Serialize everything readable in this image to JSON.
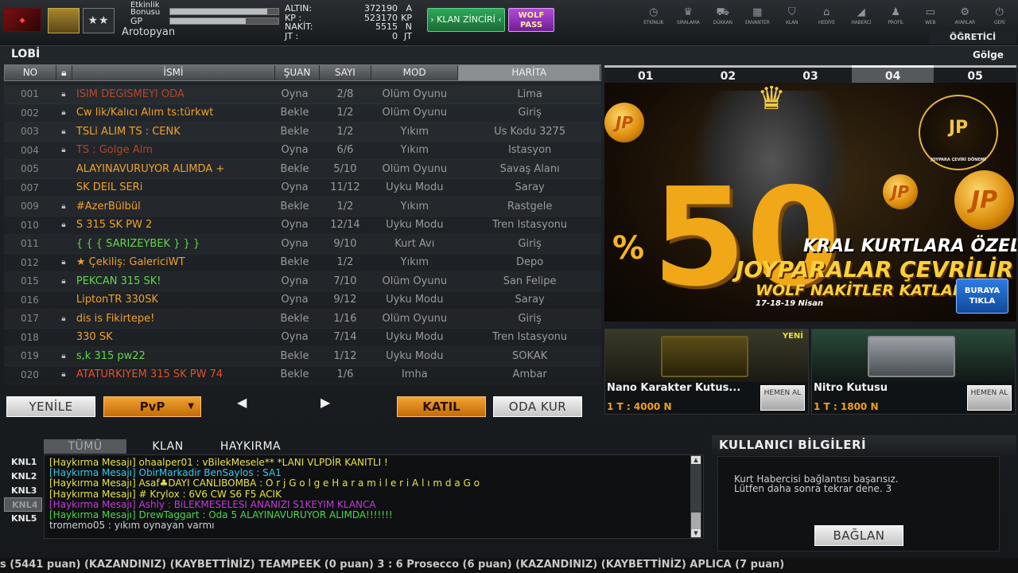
{
  "header": {
    "brand_logo_icon": "game-logo-icon",
    "rank_icon": "rank-badge-icon",
    "stars_text": "★★",
    "event_bonus_label": "Etkinlik",
    "event_bonus_label2": "Bonusu",
    "gp_label": "GP",
    "event_bonus_progress": 0.9,
    "gp_progress": 0.7,
    "username": "Arotopyan",
    "currency": [
      {
        "key": "ALTIN:",
        "value": "372190",
        "unit": "A"
      },
      {
        "key": "KP   :",
        "value": "523170",
        "unit": "KP"
      },
      {
        "key": "NAKİT:",
        "value": "5515",
        "unit": "N"
      },
      {
        "key": "JT   :",
        "value": "0",
        "unit": "JT"
      }
    ],
    "klan_chain_label": "› KLAN ZİNCİRİ ‹",
    "wolf_pass_line1": "WOLF",
    "wolf_pass_line2": "PASS",
    "nav": [
      {
        "label": "ETKİNLİK",
        "icon": "clock-icon",
        "glyph": "◷"
      },
      {
        "label": "SIRALAMA",
        "icon": "rank-icon",
        "glyph": "♛"
      },
      {
        "label": "DÜKKAN",
        "icon": "cart-icon",
        "glyph": "⛟"
      },
      {
        "label": "ENVANTER",
        "icon": "inventory-icon",
        "glyph": "▦"
      },
      {
        "label": "KLAN",
        "icon": "clan-shield-icon",
        "glyph": "⛉"
      },
      {
        "label": "HEDİYE",
        "icon": "gift-icon",
        "glyph": "⌂"
      },
      {
        "label": "HABERCİ",
        "icon": "megaphone-icon",
        "glyph": "◢"
      },
      {
        "label": "PROFİL",
        "icon": "profile-icon",
        "glyph": "♟"
      },
      {
        "label": "WEB",
        "icon": "web-icon",
        "glyph": "▭"
      },
      {
        "label": "AYARLAR",
        "icon": "settings-gear-icon",
        "glyph": "⚙"
      },
      {
        "label": "GERİ",
        "icon": "power-icon",
        "glyph": "⏻"
      }
    ],
    "tutor_label": "ÖĞRETİCİ"
  },
  "lobby": {
    "title": "LOBİ",
    "columns": {
      "no": "NO",
      "lock_icon": "lock-icon",
      "name": "İSMİ",
      "status": "ŞUAN",
      "count": "SAYI",
      "mode": "MOD",
      "map": "HARİTA"
    },
    "rooms": [
      {
        "no": "001",
        "locked": true,
        "name": "ISIM DEGISMEYI ODA",
        "name_color": "#e0532a",
        "status": "Oyna",
        "count": "2/8",
        "mode": "Ölüm Oyunu",
        "map": "Lima",
        "dim": true
      },
      {
        "no": "002",
        "locked": true,
        "name": "Cw lik/Kalıcı Alım ts:türkwt",
        "name_color": "#f0a12a",
        "status": "Bekle",
        "count": "1/2",
        "mode": "Ölüm Oyunu",
        "map": "Giriş",
        "dim": false
      },
      {
        "no": "003",
        "locked": true,
        "name": "TSLi ALIM  TS : CENK",
        "name_color": "#f0a12a",
        "status": "Bekle",
        "count": "1/2",
        "mode": "Yıkım",
        "map": "Üs Kodu 3275",
        "dim": false
      },
      {
        "no": "004",
        "locked": true,
        "name": "TS : Golge Alm",
        "name_color": "#e0532a",
        "status": "Oyna",
        "count": "6/6",
        "mode": "Yıkım",
        "map": "İstasyon",
        "dim": true
      },
      {
        "no": "005",
        "locked": false,
        "name": "ALAYINAVURUYOR ALIMDA +",
        "name_color": "#f0a12a",
        "status": "Bekle",
        "count": "5/10",
        "mode": "Ölüm Oyunu",
        "map": "Savaş Alanı",
        "dim": false
      },
      {
        "no": "007",
        "locked": false,
        "name": "SK DEIL SERi",
        "name_color": "#f0a12a",
        "status": "Oyna",
        "count": "11/12",
        "mode": "Uyku Modu",
        "map": "Saray",
        "dim": false
      },
      {
        "no": "009",
        "locked": true,
        "name": "   #AzerBülbül",
        "name_color": "#f0a12a",
        "status": "Bekle",
        "count": "1/2",
        "mode": "Yıkım",
        "map": "Rastgele",
        "dim": false
      },
      {
        "no": "010",
        "locked": true,
        "name": "S 315 SK PW 2",
        "name_color": "#f0a12a",
        "status": "Oyna",
        "count": "12/14",
        "mode": "Uyku Modu",
        "map": "Tren İstasyonu",
        "dim": false
      },
      {
        "no": "011",
        "locked": false,
        "name": "{ { { SARIZEYBEK } } }",
        "name_color": "#62d64a",
        "status": "Oyna",
        "count": "9/10",
        "mode": "Kurt Avı",
        "map": "Giriş",
        "dim": false
      },
      {
        "no": "012",
        "locked": true,
        "name": "★ Çekiliş: GalericiWT",
        "name_color": "#f0a12a",
        "status": "Bekle",
        "count": "1/2",
        "mode": "Yıkım",
        "map": "Depo",
        "dim": false
      },
      {
        "no": "015",
        "locked": true,
        "name": "PEKCAN 315 SK!",
        "name_color": "#62d64a",
        "status": "Oyna",
        "count": "7/10",
        "mode": "Ölüm Oyunu",
        "map": "San Felipe",
        "dim": false
      },
      {
        "no": "016",
        "locked": false,
        "name": "LiptonTR 330SK",
        "name_color": "#f0a12a",
        "status": "Oyna",
        "count": "9/12",
        "mode": "Uyku Modu",
        "map": "Saray",
        "dim": false
      },
      {
        "no": "017",
        "locked": true,
        "name": "dis is Fikirtepe!",
        "name_color": "#f0a12a",
        "status": "Bekle",
        "count": "1/16",
        "mode": "Ölüm Oyunu",
        "map": "Giriş",
        "dim": false
      },
      {
        "no": "018",
        "locked": false,
        "name": "330 SK",
        "name_color": "#f0a12a",
        "status": "Oyna",
        "count": "7/14",
        "mode": "Uyku Modu",
        "map": "Tren İstasyonu",
        "dim": false
      },
      {
        "no": "019",
        "locked": true,
        "name": "s,k 315 pw22",
        "name_color": "#62d64a",
        "status": "Bekle",
        "count": "1/12",
        "mode": "Uyku Modu",
        "map": "SOKAK",
        "dim": false
      },
      {
        "no": "020",
        "locked": true,
        "name": "ATATURKIYEM 315 SK PW 74",
        "name_color": "#e0532a",
        "status": "Bekle",
        "count": "1/6",
        "mode": "İmha",
        "map": "Ambar",
        "dim": false
      }
    ],
    "refresh_label": "YENİLE",
    "mode_select_value": "PvP",
    "join_label": "KATIL",
    "create_room_label": "ODA KUR"
  },
  "banner": {
    "title": "Gölge",
    "tabs": [
      "01",
      "02",
      "03",
      "04",
      "05"
    ],
    "active_tab": 3,
    "big_number": "50",
    "percent": "%",
    "line1": "KRAL KURTLARA ÖZEL",
    "line2": "JOYPARALAR ÇEVRİLİR",
    "line3": "WOLF NAKİTLER KATLAN",
    "dates": "17-18-19 Nisan",
    "badge_text": "JP",
    "badge_caption": "JOYPARA ÇEVİRİ DÖNEMİ",
    "coin_text": "JP",
    "cta_label": "BURAYA TIKLA"
  },
  "shop": [
    {
      "name": "Nano Karakter Kutus...",
      "price": "1 T : 4000 N",
      "buy_label": "HEMEN AL",
      "badge": "YENİ"
    },
    {
      "name": "Nitro Kutusu",
      "price": "1 T : 1800 N",
      "buy_label": "HEMEN AL",
      "badge": ""
    }
  ],
  "chat": {
    "tabs": [
      "TÜMÜ",
      "KLAN",
      "HAYKIRMA"
    ],
    "active_tab": 0,
    "channels": [
      "KNL1",
      "KNL2",
      "KNL3",
      "KNL4",
      "KNL5"
    ],
    "active_channel": 3,
    "messages": [
      {
        "text": "[Haykırma Mesajı] ohaalper01 : vBilekMesele** *LANI VLPDİR KANITLI  !",
        "color": "#e7e24a"
      },
      {
        "text": "[Haykırma Mesajı] ObirMarkadir BenSaylos  : SA1",
        "color": "#39c9e6"
      },
      {
        "text": "[Haykırma Mesajı] Asaf♣DAYI CANLIBOMBA : O r j   G o l g e H a r a m i l e r i   A l ı m d a   G o",
        "color": "#e7e24a"
      },
      {
        "text": "[Haykırma Mesajı] # Krylox : 6V6 CW S6 F5 ACIK",
        "color": "#e7e24a"
      },
      {
        "text": "[Haykırma Mesajı] Ashly : BiLEKMESELESI ANANIZI S1KEYIM KLANCA",
        "color": "#c43bd6"
      },
      {
        "text": "[Haykırma Mesajı] DrewTaggart : Oda 5 ALAYINAVURUYOR ALIMDA!!!!!!!",
        "color": "#4ad84a"
      },
      {
        "text": "tromemo05 : yıkım  oynayan varmı",
        "color": "#cfcfcf"
      }
    ]
  },
  "user_info": {
    "title": "KULLANICI BİLGİLERİ",
    "message_line1": "Kurt Habercisi bağlantısı başarısız.",
    "message_line2": "Lütfen daha sonra tekrar dene. 3",
    "connect_label": "BAĞLAN"
  },
  "ticker": {
    "text": "s (5441 puan) (KAZANDINIZ)      (KAYBETTİNİZ) TEAMPEEK (0 puan) 3 : 6 Prosecco (6 puan) (KAZANDINIZ)      (KAYBETTİNİZ) APLICA (7 puan)"
  }
}
